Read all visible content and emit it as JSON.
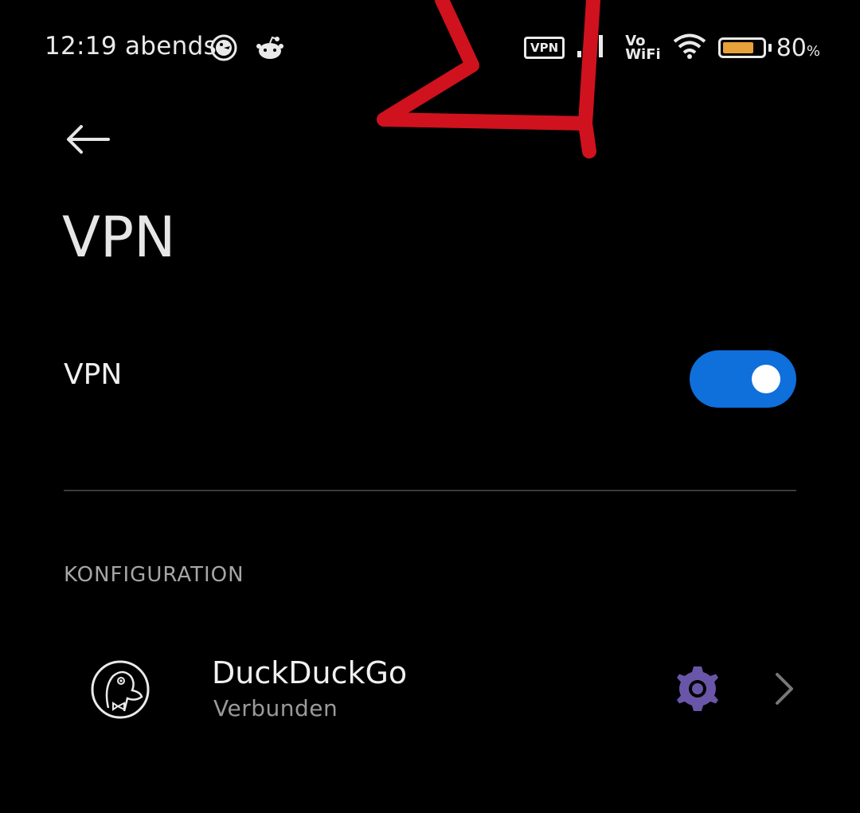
{
  "status_bar": {
    "time": "12:19 abends",
    "left_icons": [
      "duckduckgo-icon",
      "reddit-icon"
    ],
    "vpn_badge": "VPN",
    "volte_line1": "Vo",
    "volte_line2": "WiFi",
    "battery_percent": "80",
    "battery_percent_suffix": "%",
    "battery_level": 0.8,
    "battery_color": "#e6a13a"
  },
  "header": {
    "back_icon": "arrow-left-icon",
    "title": "VPN"
  },
  "vpn_toggle": {
    "label": "VPN",
    "enabled": true,
    "accent_color": "#0f6fdb"
  },
  "configuration": {
    "section_title": "KONFIGURATION",
    "items": [
      {
        "name": "DuckDuckGo",
        "status": "Verbunden",
        "icon": "duckduckgo-logo-icon",
        "settings_icon": "gear-icon",
        "settings_color": "#6a56a8",
        "chevron_icon": "chevron-right-icon"
      }
    ]
  },
  "annotation_color": "#d0121e"
}
